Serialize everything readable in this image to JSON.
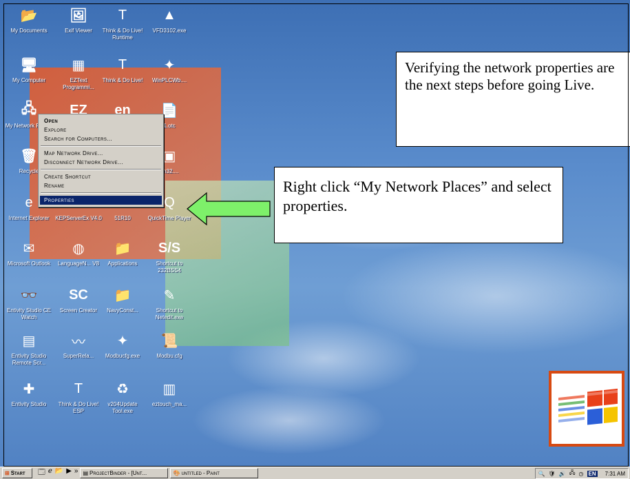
{
  "callouts": {
    "top": "Verifying the network properties are the next steps before going Live.",
    "right": "Right click “My Network Places” and select properties."
  },
  "icons": [
    {
      "label": "My Documents",
      "glyph": "📂",
      "name": "my-documents-icon"
    },
    {
      "label": "Exif Viewer",
      "glyph": "🖼",
      "name": "exif-viewer-icon"
    },
    {
      "label": "Think & Do Live! Runtime",
      "glyph": "T",
      "name": "think-do-runtime-icon"
    },
    {
      "label": "VFD3102.exe",
      "glyph": "▲",
      "name": "vfd3102-icon"
    },
    {
      "label": "My Computer",
      "glyph": "🖥",
      "name": "my-computer-icon"
    },
    {
      "label": "EZText Programmi...",
      "glyph": "▦",
      "name": "eztext-icon"
    },
    {
      "label": "Think & Do Live!",
      "glyph": "T",
      "name": "think-do-live-icon"
    },
    {
      "label": "WinPLCWb....",
      "glyph": "✦",
      "name": "winplcwb-icon"
    },
    {
      "label": "My Network Places",
      "glyph": "🖧",
      "name": "my-network-places-icon"
    },
    {
      "label": "",
      "glyph": "EZ",
      "name": "ez-icon"
    },
    {
      "label": "",
      "glyph": "en",
      "name": "en-icon"
    },
    {
      "label": "1.otc",
      "glyph": "📄",
      "name": "otc-file-icon"
    },
    {
      "label": "Recycle",
      "glyph": "🗑",
      "name": "recycle-bin-icon"
    },
    {
      "label": "",
      "glyph": "",
      "name": "hidden-icon"
    },
    {
      "label": "",
      "glyph": "",
      "name": "hidden-icon-2"
    },
    {
      "label": "an32....",
      "glyph": "▣",
      "name": "an32-icon"
    },
    {
      "label": "Internet Explorer",
      "glyph": "e",
      "name": "internet-explorer-icon"
    },
    {
      "label": "KEPServerEx V4.0",
      "glyph": "⚙",
      "name": "kepserver-icon"
    },
    {
      "label": "51R10",
      "glyph": "",
      "name": "file-51r10-icon"
    },
    {
      "label": "QuickTime Player",
      "glyph": "Q",
      "name": "quicktime-icon"
    },
    {
      "label": "Microsoft Outlook",
      "glyph": "✉",
      "name": "outlook-icon"
    },
    {
      "label": "LanguageN... V8",
      "glyph": "◍",
      "name": "languagen-icon"
    },
    {
      "label": "Applications",
      "glyph": "📁",
      "name": "applications-folder-icon"
    },
    {
      "label": "Shortcut to 232BSS4",
      "glyph": "S/S",
      "name": "shortcut-232bss4-icon"
    },
    {
      "label": "Entivity Studio CE Watch",
      "glyph": "👓",
      "name": "entivity-ce-watch-icon"
    },
    {
      "label": "Screen Creator",
      "glyph": "SC",
      "name": "screen-creator-icon"
    },
    {
      "label": "NavyConst...",
      "glyph": "📁",
      "name": "navyconst-folder-icon"
    },
    {
      "label": "Shortcut to Netedit.exe",
      "glyph": "✎",
      "name": "netedit-icon"
    },
    {
      "label": "Entivity Studio Remote Scr...",
      "glyph": "▤",
      "name": "entivity-remote-icon"
    },
    {
      "label": "SuperRela...",
      "glyph": "〰",
      "name": "superrela-icon"
    },
    {
      "label": "Modbucfg.exe",
      "glyph": "✦",
      "name": "modbucfg-icon"
    },
    {
      "label": "Modbu.cfg",
      "glyph": "📜",
      "name": "modbu-cfg-icon"
    },
    {
      "label": "Entivity Studio",
      "glyph": "✚",
      "name": "entivity-studio-icon"
    },
    {
      "label": "Think & Do Live! ESP",
      "glyph": "T",
      "name": "think-do-esp-icon"
    },
    {
      "label": "v204Update Tool.exe",
      "glyph": "♻",
      "name": "v204update-icon"
    },
    {
      "label": "eztouch_ma...",
      "glyph": "▥",
      "name": "eztouch-icon"
    }
  ],
  "menu": {
    "open": "Open",
    "explore": "Explore",
    "search": "Search for Computers...",
    "map": "Map Network Drive...",
    "disconnect": "Disconnect Network Drive...",
    "shortcut": "Create Shortcut",
    "rename": "Rename",
    "properties": "Properties"
  },
  "taskbar": {
    "start": "Start",
    "more": "»",
    "task1": "ProjectBinder - [Unt...",
    "task2": "untitled - Paint",
    "lang": "EN",
    "clock": "7:31 AM"
  },
  "colors": {
    "selection": "#0a246a",
    "arrow": "#7ef06a",
    "logo_border": "#d74a12"
  }
}
